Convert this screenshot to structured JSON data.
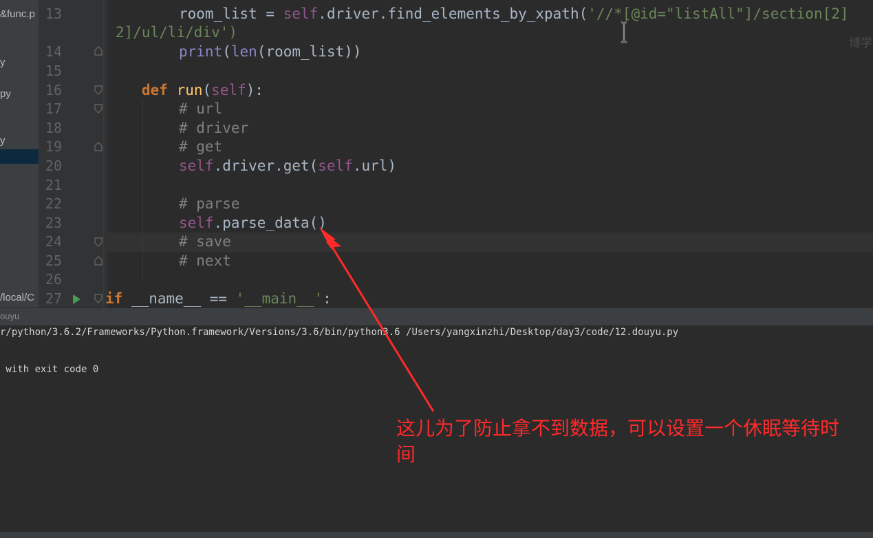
{
  "sidebar": {
    "items": [
      "&func.p",
      "y",
      "py",
      "y",
      "/local/C"
    ]
  },
  "editor": {
    "lines": [
      {
        "num": "13",
        "text": "room_list = self.driver.find_elements_by_xpath('//*[@id=\"listAll\"]/section[2]"
      },
      {
        "num": "",
        "text": "2]/ul/li/div')"
      },
      {
        "num": "14",
        "text": "print(len(room_list))"
      },
      {
        "num": "15",
        "text": ""
      },
      {
        "num": "16",
        "text": "def run(self):"
      },
      {
        "num": "17",
        "text": "# url"
      },
      {
        "num": "18",
        "text": "# driver"
      },
      {
        "num": "19",
        "text": "# get"
      },
      {
        "num": "20",
        "text": "self.driver.get(self.url)"
      },
      {
        "num": "21",
        "text": ""
      },
      {
        "num": "22",
        "text": "# parse"
      },
      {
        "num": "23",
        "text": "self.parse_data()"
      },
      {
        "num": "24",
        "text": "# save"
      },
      {
        "num": "25",
        "text": "# next"
      },
      {
        "num": "26",
        "text": ""
      },
      {
        "num": "27",
        "text": "if __name__ == '__main__':"
      }
    ]
  },
  "console": {
    "tab_label": "ouyu",
    "command": "r/python/3.6.2/Frameworks/Python.framework/Versions/3.6/bin/python3.6 /Users/yangxinzhi/Desktop/day3/code/12.douyu.py",
    "exit_line": " with exit code 0"
  },
  "annotation": {
    "text": "这儿为了防止拿不到数据，可以设置一个休眠等待时间",
    "color": "#ff2a2a"
  },
  "watermark": "博学"
}
